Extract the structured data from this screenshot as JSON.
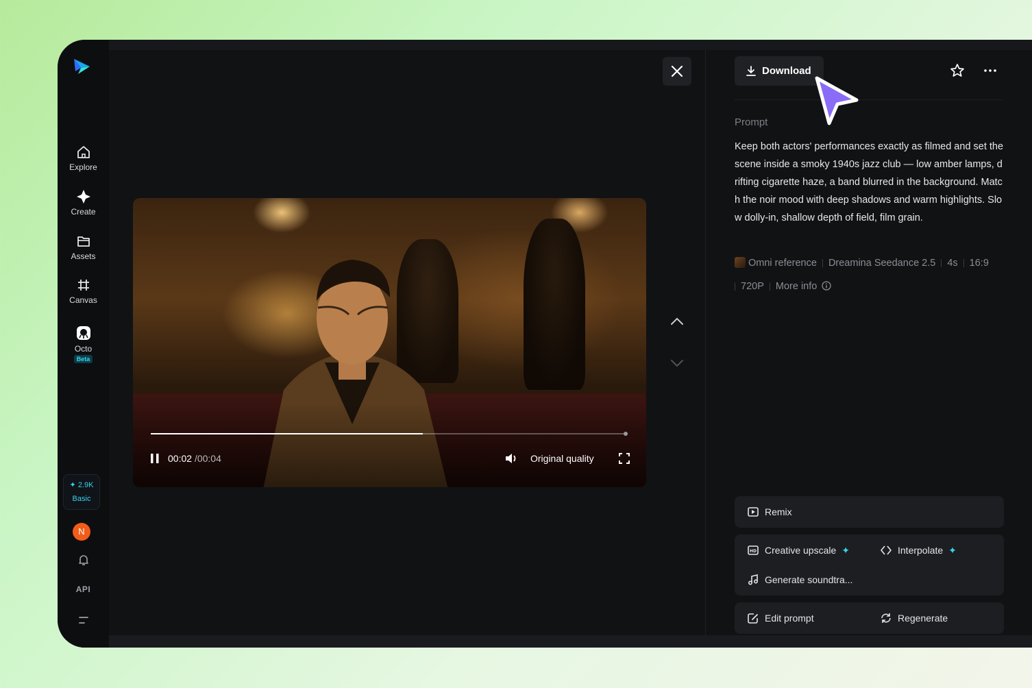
{
  "sidebar": {
    "items": [
      {
        "label": "Explore",
        "icon": "home-icon"
      },
      {
        "label": "Create",
        "icon": "sparkle-icon"
      },
      {
        "label": "Assets",
        "icon": "folder-icon"
      },
      {
        "label": "Canvas",
        "icon": "canvas-icon"
      },
      {
        "label": "Octo",
        "icon": "octo-icon",
        "badge": "Beta"
      }
    ],
    "credits": {
      "amount": "2.9K",
      "plan": "Basic"
    },
    "avatar_letter": "N",
    "api_label": "API"
  },
  "player": {
    "time_current": "00:02",
    "time_separator": "/",
    "time_total": "00:04",
    "progress_fraction": 0.57,
    "quality_label": "Original quality"
  },
  "detail": {
    "download_label": "Download",
    "prompt_heading": "Prompt",
    "prompt_text": "Keep both actors' performances exactly as filmed and set the scene inside a smoky 1940s jazz club — low amber lamps, drifting cigarette haze, a band blurred in the background. Match the noir mood with deep shadows and warm highlights. Slow dolly-in, shallow depth of field, film grain.",
    "meta": {
      "reference": "Omni reference",
      "model": "Dreamina Seedance 2.5",
      "duration": "4s",
      "ratio": "16:9",
      "resolution": "720P",
      "more_info": "More info"
    }
  },
  "actions": {
    "remix": "Remix",
    "creative_upscale": "Creative upscale",
    "interpolate": "Interpolate",
    "generate_soundtrack": "Generate soundtra...",
    "edit_prompt": "Edit prompt",
    "regenerate": "Regenerate"
  },
  "colors": {
    "accent": "#33d6ef",
    "avatar": "#f25c19",
    "cursor": "#8b6cf6",
    "panel": "#1c1e21"
  }
}
